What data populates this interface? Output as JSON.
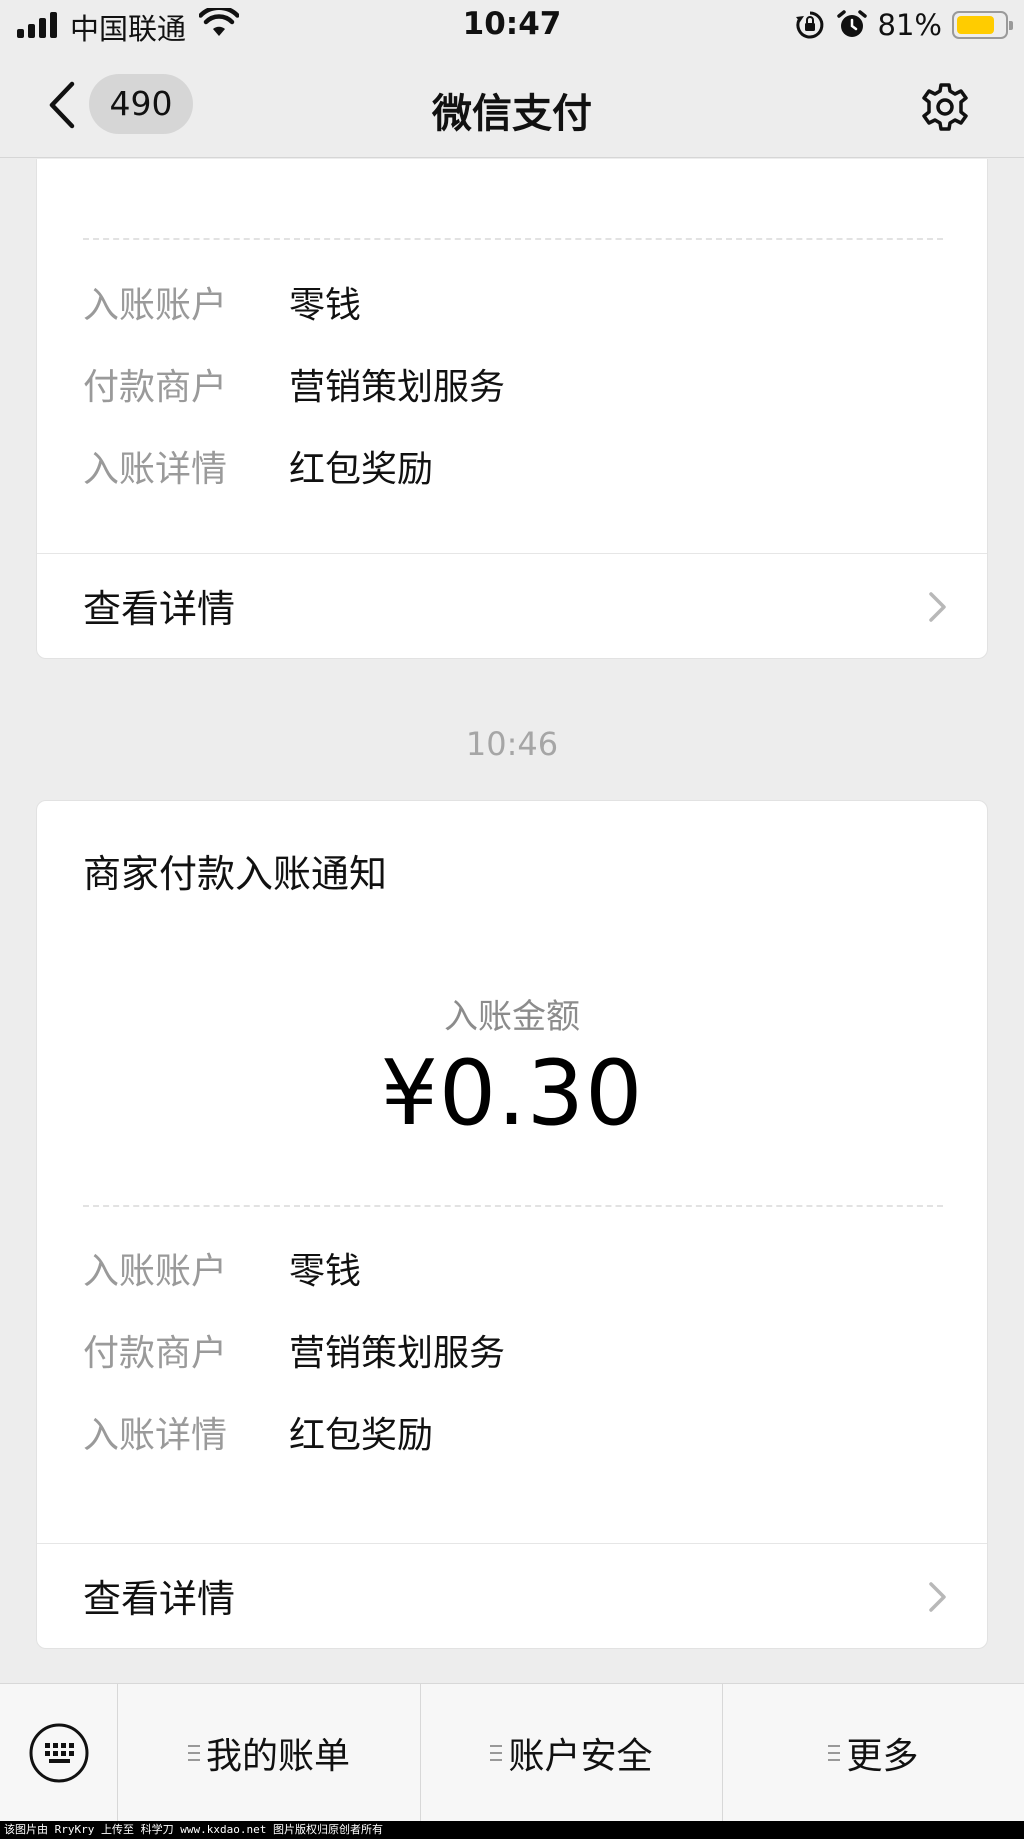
{
  "status_bar": {
    "carrier": "中国联通",
    "time": "10:47",
    "battery_percent": "81%",
    "battery_level": 0.81,
    "battery_color": "#ffcc00"
  },
  "nav": {
    "unread_count": "490",
    "title": "微信支付"
  },
  "cards": [
    {
      "rows": [
        {
          "label": "入账账户",
          "value": "零钱"
        },
        {
          "label": "付款商户",
          "value": "营销策划服务"
        },
        {
          "label": "入账详情",
          "value": "红包奖励"
        }
      ],
      "detail_link": "查看详情"
    },
    {
      "title": "商家付款入账通知",
      "amount_label": "入账金额",
      "amount": "¥0.30",
      "rows": [
        {
          "label": "入账账户",
          "value": "零钱"
        },
        {
          "label": "付款商户",
          "value": "营销策划服务"
        },
        {
          "label": "入账详情",
          "value": "红包奖励"
        }
      ],
      "detail_link": "查看详情"
    }
  ],
  "timestamp": "10:46",
  "bottom_menu": [
    {
      "label": "我的账单"
    },
    {
      "label": "账户安全"
    },
    {
      "label": "更多"
    }
  ],
  "footer_text": "该图片由 RryKry 上传至 科学刀 www.kxdao.net 图片版权归原创者所有"
}
